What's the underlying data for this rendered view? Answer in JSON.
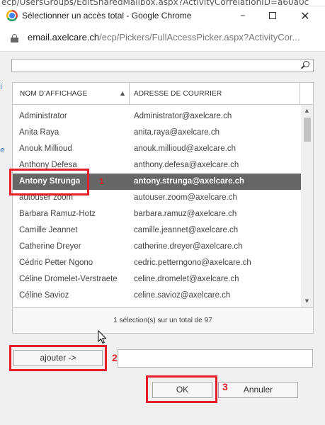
{
  "background_url": "ecp/UsersGroups/EditSharedMailbox.aspx?ActivityCorrelationID=a60a0c",
  "window": {
    "title": "Sélectionner un accès total - Google Chrome",
    "minimize": "–",
    "close": "✕"
  },
  "address_bar": {
    "host": "email.axelcare.ch",
    "path": "/ecp/Pickers/FullAccessPicker.aspx?ActivityCor..."
  },
  "search": {
    "value": "",
    "placeholder": ""
  },
  "left_edge_glyphs": [
    "i",
    "e"
  ],
  "grid": {
    "columns": [
      "NOM D'AFFICHAGE",
      "ADRESSE DE COURRIER"
    ],
    "sort_indicator": "▲",
    "rows": [
      {
        "name": "Administrator",
        "email": "Administrator@axelcare.ch"
      },
      {
        "name": "Anita Raya",
        "email": "anita.raya@axelcare.ch"
      },
      {
        "name": "Anouk Millioud",
        "email": "anouk.millioud@axelcare.ch"
      },
      {
        "name": "Anthony Defesa",
        "email": "anthony.defesa@axelcare.ch"
      },
      {
        "name": "Antony Strunga",
        "email": "antony.strunga@axelcare.ch"
      },
      {
        "name": "autouser zoom",
        "email": "autouser.zoom@axelcare.ch"
      },
      {
        "name": "Barbara Ramuz-Hotz",
        "email": "barbara.ramuz@axelcare.ch"
      },
      {
        "name": "Camille Jeannet",
        "email": "camille.jeannet@axelcare.ch"
      },
      {
        "name": "Catherine Dreyer",
        "email": "catherine.dreyer@axelcare.ch"
      },
      {
        "name": "Cédric Petter Ngono",
        "email": "cedric.petterngono@axelcare.ch"
      },
      {
        "name": "Céline Dromelet-Verstraete",
        "email": "celine.dromelet@axelcare.ch"
      },
      {
        "name": "Céline Savioz",
        "email": "celine.savioz@axelcare.ch"
      }
    ],
    "selected_index": 4,
    "scroll_up": "▲",
    "scroll_down": "▼",
    "footer": "1 sélection(s) sur un total de 97"
  },
  "buttons": {
    "add": "ajouter ->",
    "ok": "OK",
    "cancel": "Annuler"
  },
  "added_field": {
    "value": ""
  },
  "annotations": {
    "color": "#e41e2a",
    "steps": [
      "1",
      "2",
      "3"
    ]
  },
  "colors": {
    "selected_row_bg": "#666666",
    "dialog_bg": "#f0f0f0"
  }
}
